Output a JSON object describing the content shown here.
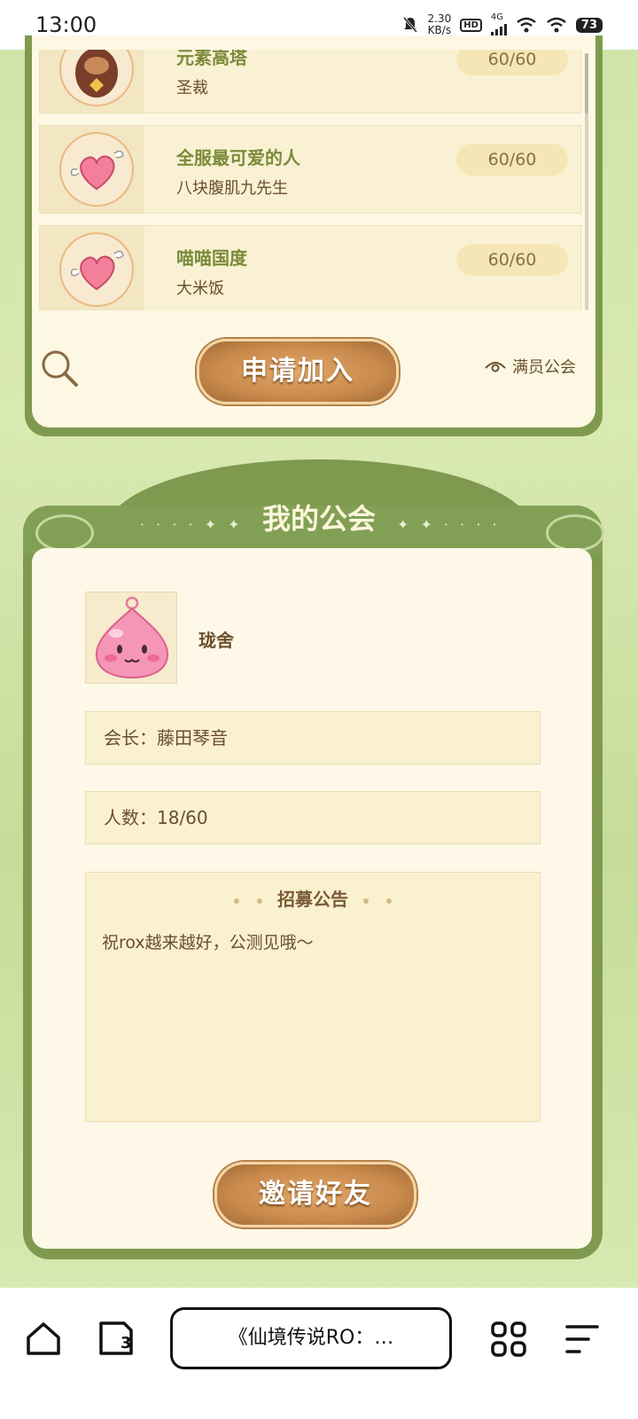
{
  "status_bar": {
    "time": "13:00",
    "speed_value": "2.30",
    "speed_unit": "KB/s",
    "hd_label": "HD",
    "network_label": "4G",
    "battery": "73",
    "icons": [
      "mute-bell-icon",
      "hd-icon",
      "signal-icon",
      "wifi-plus-icon",
      "wifi-icon",
      "battery-icon"
    ]
  },
  "guild_list": {
    "items": [
      {
        "name": "元素高塔",
        "leader": "圣裁",
        "count": "60/60",
        "icon": "demon-emblem-icon"
      },
      {
        "name": "全服最可爱的人",
        "leader": "八块腹肌九先生",
        "count": "60/60",
        "icon": "winged-heart-icon"
      },
      {
        "name": "喵喵国度",
        "leader": "大米饭",
        "count": "60/60",
        "icon": "winged-heart-icon"
      }
    ],
    "apply_button": "申请加入",
    "full_guild_label": "满员公会",
    "icons": {
      "search": "search-icon",
      "eye": "eye-icon"
    }
  },
  "my_guild": {
    "title": "我的公会",
    "guild_name": "珑舍",
    "leader_label": "会长：藤田琴音",
    "member_label": "人数：18/60",
    "notice_title": "招募公告",
    "notice_text": "祝rox越来越好，公测见哦～",
    "invite_button": "邀请好友",
    "avatar_icon": "pink-poring-icon"
  },
  "browser_nav": {
    "address_text": "《仙境传说RO：…",
    "tab_count": "3",
    "icons": [
      "home-icon",
      "tabs-icon",
      "apps-grid-icon",
      "menu-icon"
    ]
  },
  "colors": {
    "frame_green": "#7f9a4f",
    "panel_cream": "#fdf8e4",
    "guild_name_green": "#7a8b3a",
    "text_brown": "#6b4f2c",
    "button_orange": "#c98a4c"
  }
}
